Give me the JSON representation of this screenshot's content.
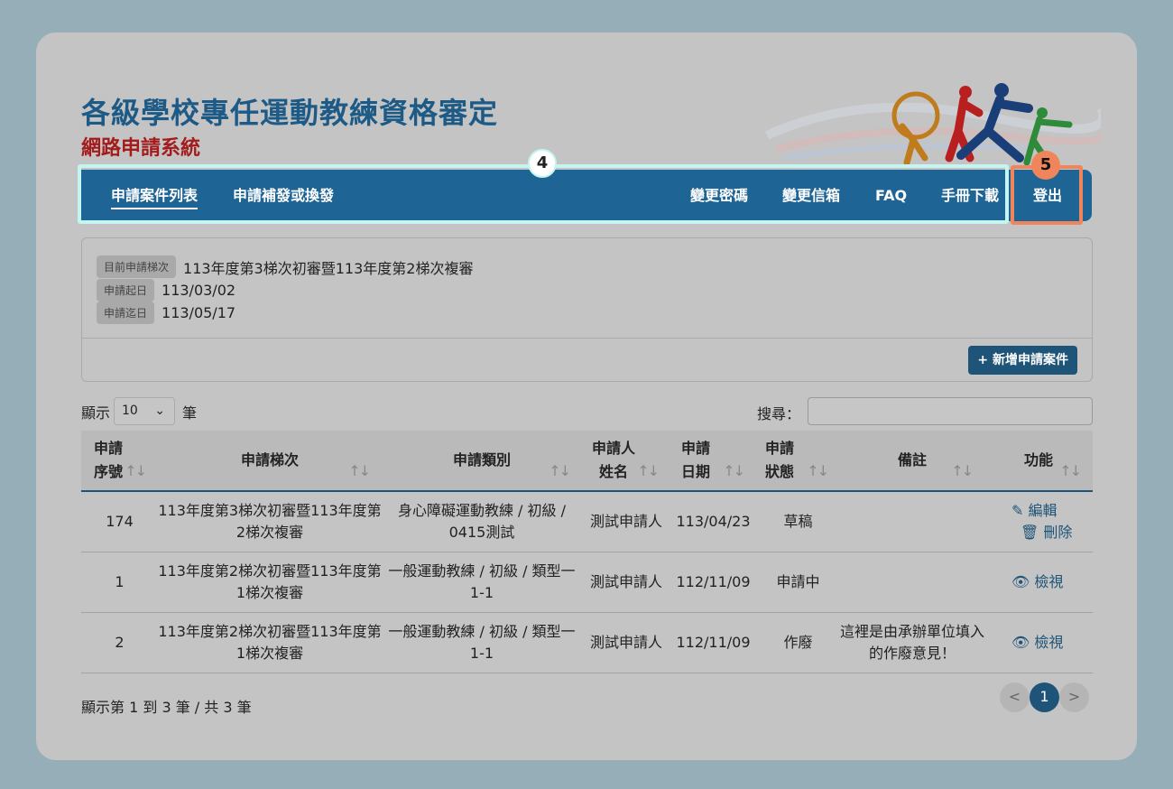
{
  "header": {
    "title": "各級學校專任運動教練資格審定",
    "subtitle": "網路申請系統"
  },
  "nav": {
    "left": [
      "申請案件列表",
      "申請補發或換發"
    ],
    "right": [
      "變更密碼",
      "變更信箱",
      "FAQ",
      "手冊下載"
    ],
    "logout": "登出"
  },
  "markers": {
    "m4": "4",
    "m5": "5"
  },
  "info": {
    "round_label": "目前申請梯次",
    "round_value": "113年度第3梯次初審暨113年度第2梯次複審",
    "start_label": "申請起日",
    "start_value": "113/03/02",
    "end_label": "申請迄日",
    "end_value": "113/05/17",
    "add_button": "+ 新增申請案件"
  },
  "list_controls": {
    "show_prefix": "顯示",
    "page_size": "10",
    "show_suffix": "筆",
    "search_label": "搜尋："
  },
  "table": {
    "headers": [
      "申請序號",
      "申請梯次",
      "申請類別",
      "申請人姓名",
      "申請日期",
      "申請狀態",
      "備註",
      "功能"
    ],
    "rows": [
      {
        "no": "174",
        "round": "113年度第3梯次初審暨113年度第2梯次複審",
        "type": "身心障礙運動教練 / 初級 / 0415測試",
        "name": "測試申請人",
        "date": "113/04/23",
        "status": "草稿",
        "note": ""
      },
      {
        "no": "1",
        "round": "113年度第2梯次初審暨113年度第1梯次複審",
        "type": "一般運動教練 / 初級 / 類型一1-1",
        "name": "測試申請人",
        "date": "112/11/09",
        "status": "申請中",
        "note": ""
      },
      {
        "no": "2",
        "round": "113年度第2梯次初審暨113年度第1梯次複審",
        "type": "一般運動教練 / 初級 / 類型一1-1",
        "name": "測試申請人",
        "date": "112/11/09",
        "status": "作廢",
        "note": "這裡是由承辦單位填入的作廢意見！"
      }
    ],
    "actions": {
      "edit": "編輯",
      "delete": "刪除",
      "view": "檢視"
    }
  },
  "footer": {
    "summary": "顯示第 1 到 3 筆 / 共 3 筆",
    "prev": "<",
    "page": "1",
    "next": ">"
  }
}
